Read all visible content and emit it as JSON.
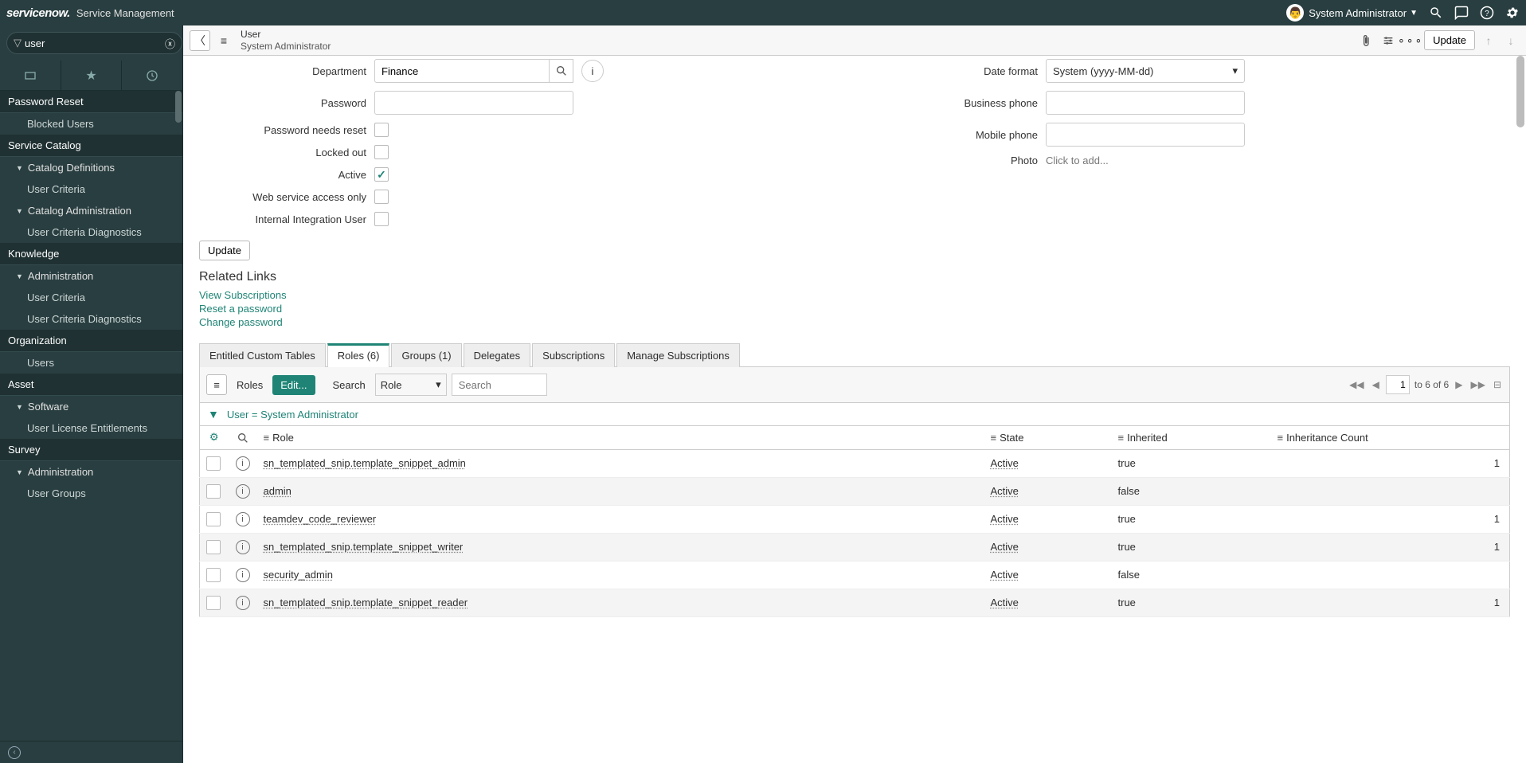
{
  "banner": {
    "logo": "servicenow.",
    "product": "Service Management",
    "user_name": "System Administrator"
  },
  "nav": {
    "filter_value": "user",
    "apps": [
      {
        "name": "Password Reset",
        "children": [
          {
            "type": "sub",
            "label": "Blocked Users"
          }
        ]
      },
      {
        "name": "Service Catalog",
        "children": [
          {
            "type": "mod",
            "label": "Catalog Definitions"
          },
          {
            "type": "sub",
            "label": "User Criteria"
          },
          {
            "type": "mod",
            "label": "Catalog Administration"
          },
          {
            "type": "sub",
            "label": "User Criteria Diagnostics"
          }
        ]
      },
      {
        "name": "Knowledge",
        "children": [
          {
            "type": "mod",
            "label": "Administration"
          },
          {
            "type": "sub",
            "label": "User Criteria"
          },
          {
            "type": "sub",
            "label": "User Criteria Diagnostics"
          }
        ]
      },
      {
        "name": "Organization",
        "children": [
          {
            "type": "sub",
            "label": "Users",
            "selected": true
          }
        ]
      },
      {
        "name": "Asset",
        "children": [
          {
            "type": "mod",
            "label": "Software"
          },
          {
            "type": "sub",
            "label": "User License Entitlements"
          }
        ]
      },
      {
        "name": "Survey",
        "children": [
          {
            "type": "mod",
            "label": "Administration"
          },
          {
            "type": "sub",
            "label": "User Groups"
          }
        ]
      }
    ]
  },
  "header": {
    "title1": "User",
    "title2": "System Administrator",
    "update_btn": "Update"
  },
  "form": {
    "left": {
      "department_label": "Department",
      "department_value": "Finance",
      "password_label": "Password",
      "needs_reset_label": "Password needs reset",
      "locked_label": "Locked out",
      "active_label": "Active",
      "ws_label": "Web service access only",
      "iiu_label": "Internal Integration User"
    },
    "right": {
      "date_format_label": "Date format",
      "date_format_value": "System (yyyy-MM-dd)",
      "bphone_label": "Business phone",
      "mphone_label": "Mobile phone",
      "photo_label": "Photo",
      "photo_value": "Click to add..."
    },
    "update_btn2": "Update"
  },
  "related": {
    "title": "Related Links",
    "links": [
      "View Subscriptions",
      "Reset a password",
      "Change password"
    ]
  },
  "tabs": [
    "Entitled Custom Tables",
    "Roles (6)",
    "Groups (1)",
    "Delegates",
    "Subscriptions",
    "Manage Subscriptions"
  ],
  "active_tab": 1,
  "list": {
    "title": "Roles",
    "edit": "Edit...",
    "search_label": "Search",
    "search_field": "Role",
    "search_placeholder": "Search",
    "page_current": "1",
    "page_info": "to 6 of 6",
    "breadcrumb": "User = System Administrator",
    "columns": [
      "Role",
      "State",
      "Inherited",
      "Inheritance Count"
    ],
    "rows": [
      {
        "role": "sn_templated_snip.template_snippet_admin",
        "state": "Active",
        "inherited": "true",
        "count": "1"
      },
      {
        "role": "admin",
        "state": "Active",
        "inherited": "false",
        "count": ""
      },
      {
        "role": "teamdev_code_reviewer",
        "state": "Active",
        "inherited": "true",
        "count": "1"
      },
      {
        "role": "sn_templated_snip.template_snippet_writer",
        "state": "Active",
        "inherited": "true",
        "count": "1"
      },
      {
        "role": "security_admin",
        "state": "Active",
        "inherited": "false",
        "count": ""
      },
      {
        "role": "sn_templated_snip.template_snippet_reader",
        "state": "Active",
        "inherited": "true",
        "count": "1"
      }
    ]
  }
}
